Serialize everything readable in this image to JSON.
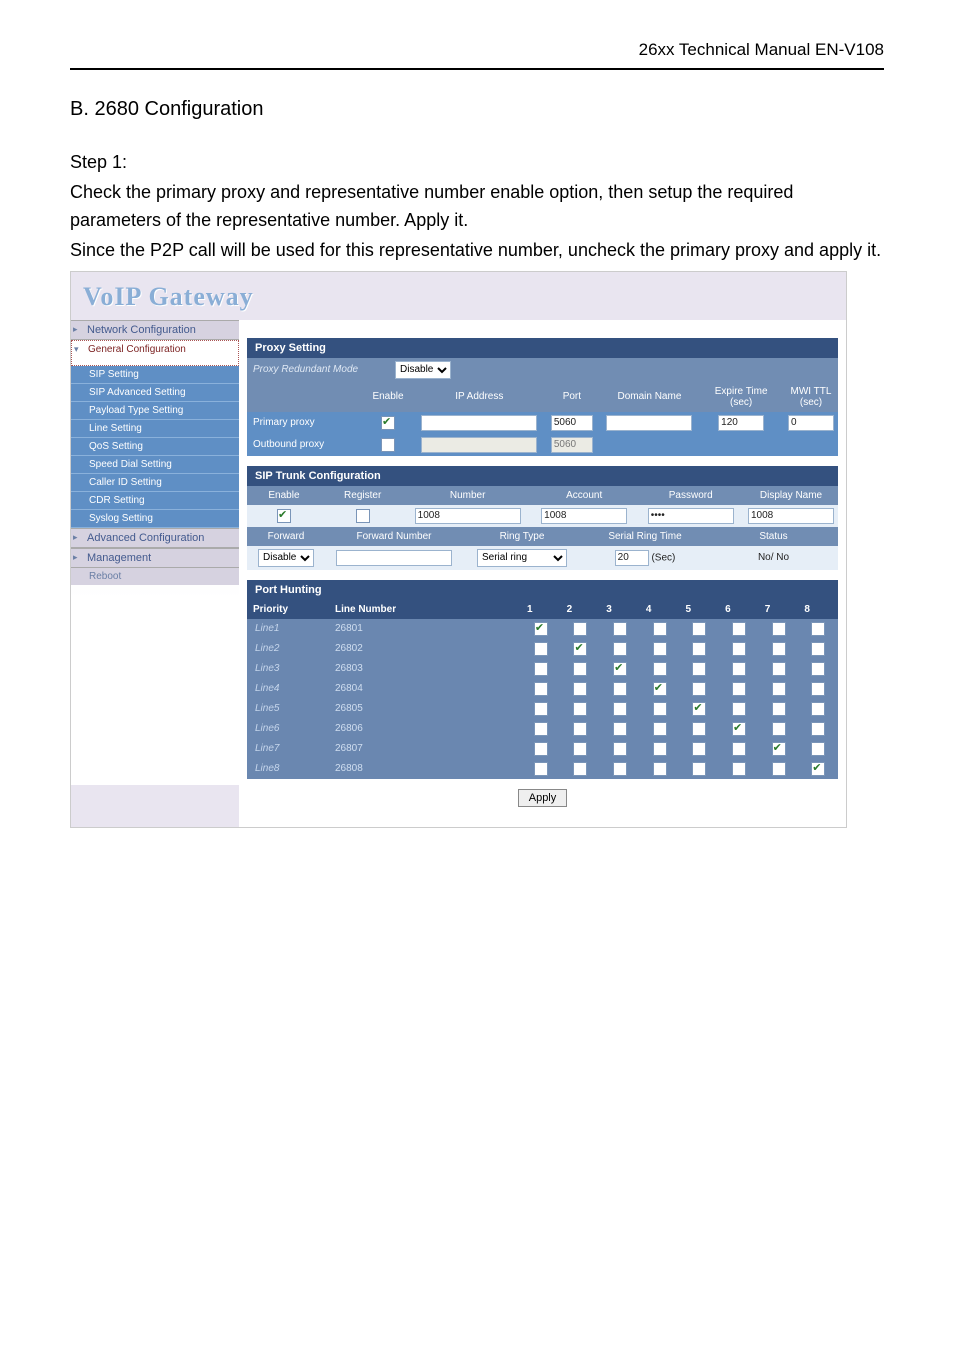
{
  "header": "26xx Technical Manual EN-V108",
  "title": "B. 2680 Configuration",
  "step_label": "Step 1:",
  "para1": "Check the primary proxy and representative number enable option, then setup the required parameters of the representative number. Apply it.",
  "para2": "Since the P2P call will be used for this representative number, uncheck the primary proxy and apply it.",
  "app_title": "VoIP Gateway",
  "nav": {
    "network_configuration": "Network Configuration",
    "general_configuration": "General Configuration",
    "items": [
      "SIP Setting",
      "SIP Advanced Setting",
      "Payload Type Setting",
      "Line Setting",
      "QoS Setting",
      "Speed Dial Setting",
      "Caller ID Setting",
      "CDR Setting",
      "Syslog Setting"
    ],
    "advanced_configuration": "Advanced Configuration",
    "management": "Management",
    "reboot": "Reboot"
  },
  "proxy": {
    "title": "Proxy Setting",
    "redundant_label": "Proxy Redundant Mode",
    "redundant_value": "Disable",
    "cols": {
      "enable": "Enable",
      "ip": "IP Address",
      "port": "Port",
      "domain": "Domain Name",
      "expire": "Expire Time (sec)",
      "mwi": "MWI TTL (sec)"
    },
    "primary": {
      "label": "Primary proxy",
      "enable": true,
      "ip": "",
      "port": "5060",
      "domain": "",
      "expire": "120",
      "mwi": "0"
    },
    "outbound": {
      "label": "Outbound proxy",
      "enable": false,
      "ip": "",
      "port": "5060"
    }
  },
  "trunk": {
    "title": "SIP Trunk Configuration",
    "cols1": {
      "enable": "Enable",
      "register": "Register",
      "number": "Number",
      "account": "Account",
      "password": "Password",
      "display": "Display Name"
    },
    "row1": {
      "enable": true,
      "register": false,
      "number": "1008",
      "account": "1008",
      "password": "••••",
      "display": "1008"
    },
    "cols2": {
      "forward": "Forward",
      "forward_number": "Forward Number",
      "ring_type": "Ring Type",
      "serial_ring_time": "Serial Ring Time",
      "status": "Status"
    },
    "row2": {
      "forward": "Disable",
      "forward_number": "",
      "ring_type": "Serial ring",
      "serial_ring_time": "20",
      "serial_unit": "(Sec)",
      "status": "No/ No"
    }
  },
  "port_hunting": {
    "title": "Port Hunting",
    "priority": "Priority",
    "line_number": "Line Number",
    "cols": [
      "1",
      "2",
      "3",
      "4",
      "5",
      "6",
      "7",
      "8"
    ],
    "rows": [
      {
        "priority": "Line1",
        "line": "26801",
        "checks": [
          true,
          false,
          false,
          false,
          false,
          false,
          false,
          false
        ]
      },
      {
        "priority": "Line2",
        "line": "26802",
        "checks": [
          false,
          true,
          false,
          false,
          false,
          false,
          false,
          false
        ]
      },
      {
        "priority": "Line3",
        "line": "26803",
        "checks": [
          false,
          false,
          true,
          false,
          false,
          false,
          false,
          false
        ]
      },
      {
        "priority": "Line4",
        "line": "26804",
        "checks": [
          false,
          false,
          false,
          true,
          false,
          false,
          false,
          false
        ]
      },
      {
        "priority": "Line5",
        "line": "26805",
        "checks": [
          false,
          false,
          false,
          false,
          true,
          false,
          false,
          false
        ]
      },
      {
        "priority": "Line6",
        "line": "26806",
        "checks": [
          false,
          false,
          false,
          false,
          false,
          true,
          false,
          false
        ]
      },
      {
        "priority": "Line7",
        "line": "26807",
        "checks": [
          false,
          false,
          false,
          false,
          false,
          false,
          true,
          false
        ]
      },
      {
        "priority": "Line8",
        "line": "26808",
        "checks": [
          false,
          false,
          false,
          false,
          false,
          false,
          false,
          true
        ]
      }
    ]
  },
  "apply_label": "Apply"
}
